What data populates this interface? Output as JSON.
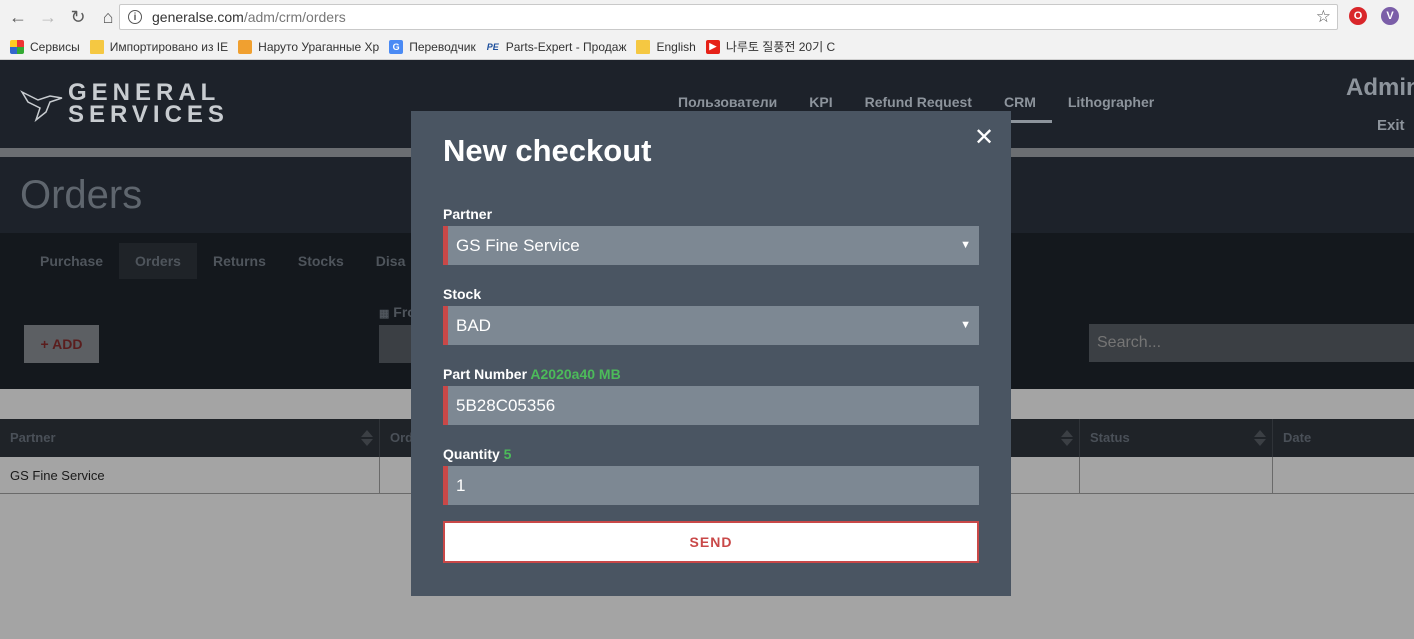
{
  "browser": {
    "url_domain": "generalse.com",
    "url_path": "/adm/crm/orders",
    "bookmarks": [
      {
        "label": "Сервисы"
      },
      {
        "label": "Импортировано из IE"
      },
      {
        "label": "Наруто Ураганные Хр"
      },
      {
        "label": "Переводчик"
      },
      {
        "label": "Parts-Expert - Продаж"
      },
      {
        "label": "English"
      },
      {
        "label": "나루토 질풍전 20기 C"
      }
    ],
    "back_icon": "back-arrow-icon",
    "forward_icon": "forward-arrow-icon",
    "reload_icon": "reload-icon",
    "home_icon": "home-icon"
  },
  "header": {
    "logo_line1": "GENERAL",
    "logo_line2": "SERVICES",
    "nav": [
      {
        "label": "Пользователи"
      },
      {
        "label": "KPI"
      },
      {
        "label": "Refund Request"
      },
      {
        "label": "CRM"
      },
      {
        "label": "Lithographer"
      }
    ],
    "user_label": "Admin",
    "exit_label": "Exit"
  },
  "page": {
    "title": "Orders",
    "tabs": [
      {
        "label": "Purchase"
      },
      {
        "label": "Orders"
      },
      {
        "label": "Returns"
      },
      {
        "label": "Stocks"
      },
      {
        "label": "Disa"
      }
    ],
    "add_label": "+ ADD",
    "from_label": "Fro",
    "search_placeholder": "Search..."
  },
  "table": {
    "columns": [
      "Partner",
      "Ord",
      "Status",
      "Date"
    ],
    "rows": [
      {
        "partner": "GS Fine Service"
      }
    ]
  },
  "modal": {
    "title": "New checkout",
    "partner_label": "Partner",
    "partner_value": "GS Fine Service",
    "stock_label": "Stock",
    "stock_value": "BAD",
    "part_number_label": "Part Number",
    "part_number_hint": "A2020a40 MB",
    "part_number_value": "5B28C05356",
    "quantity_label": "Quantity",
    "quantity_hint": "5",
    "quantity_value": "1",
    "send_label": "SEND"
  },
  "colors": {
    "accent_red": "#c94848",
    "hint_green": "#4cbb5a",
    "modal_bg": "#4a5562"
  }
}
